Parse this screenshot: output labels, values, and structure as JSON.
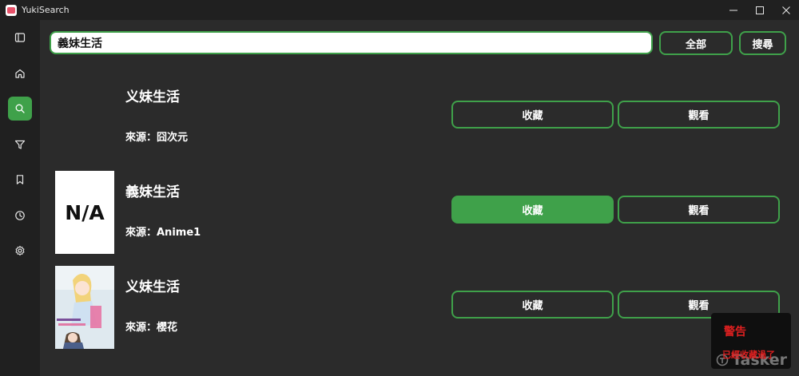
{
  "app": {
    "title": "YukiSearch",
    "icon": "app-icon"
  },
  "window_controls": [
    "minimize-icon",
    "maximize-icon",
    "close-icon"
  ],
  "sidebar": {
    "items": [
      {
        "name": "toggle-sidebar",
        "icon": "sidebar-toggle-icon",
        "active": false
      },
      {
        "name": "home",
        "icon": "home-icon",
        "active": false
      },
      {
        "name": "search",
        "icon": "search-icon",
        "active": true
      },
      {
        "name": "filter",
        "icon": "filter-icon",
        "active": false
      },
      {
        "name": "bookmarks",
        "icon": "bookmark-icon",
        "active": false
      },
      {
        "name": "history",
        "icon": "clock-icon",
        "active": false
      },
      {
        "name": "settings",
        "icon": "gear-icon",
        "active": false
      }
    ]
  },
  "search": {
    "value": "義妹生活",
    "placeholder": ""
  },
  "toolbar": {
    "filter_label": "全部",
    "search_label": "搜尋"
  },
  "results": [
    {
      "title": "义妹生活",
      "source": "來源：囧次元",
      "thumbnail": "none",
      "favorite_label": "收藏",
      "favorited": false,
      "watch_label": "觀看"
    },
    {
      "title": "義妹生活",
      "source": "來源：Anime1",
      "thumbnail": "N/A",
      "favorite_label": "收藏",
      "favorited": true,
      "watch_label": "觀看"
    },
    {
      "title": "义妹生活",
      "source": "來源：櫻花",
      "thumbnail": "poster-image",
      "favorite_label": "收藏",
      "favorited": false,
      "watch_label": "觀看"
    }
  ],
  "toast": {
    "title": "警告",
    "message": "已經收藏過了",
    "watermark": "Tasker"
  },
  "colors": {
    "accent": "#3fa14a",
    "background": "#2b2b2b",
    "sidebar": "#202020",
    "warning": "#e02020"
  }
}
